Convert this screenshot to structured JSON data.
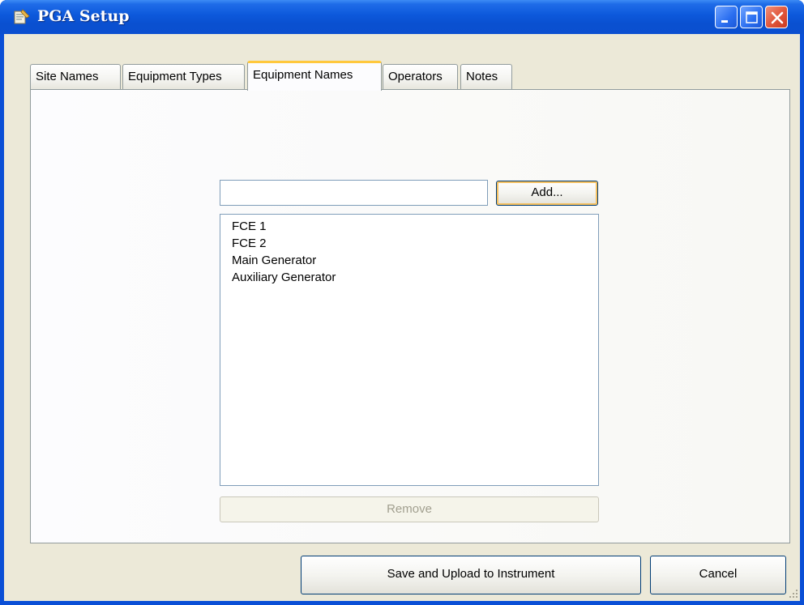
{
  "window": {
    "title": "PGA Setup"
  },
  "tabs": [
    {
      "label": "Site Names",
      "active": false
    },
    {
      "label": "Equipment Types",
      "active": false
    },
    {
      "label": "Equipment Names",
      "active": true
    },
    {
      "label": "Operators",
      "active": false
    },
    {
      "label": "Notes",
      "active": false
    }
  ],
  "equipment_names": {
    "input_value": "",
    "add_label": "Add...",
    "items": [
      "FCE 1",
      "FCE 2",
      "Main Generator",
      "Auxiliary Generator"
    ],
    "remove_label": "Remove"
  },
  "footer": {
    "save_label": "Save and Upload to Instrument",
    "cancel_label": "Cancel"
  },
  "colors": {
    "titlebar": "#0a50d0",
    "client_bg": "#ece9d8",
    "active_tab_accent": "#ffc83c",
    "close_button": "#e0553a"
  },
  "icons": {
    "app": "app-icon",
    "minimize": "minimize-icon",
    "maximize": "maximize-icon",
    "close": "close-icon",
    "grip": "resize-grip-icon"
  }
}
